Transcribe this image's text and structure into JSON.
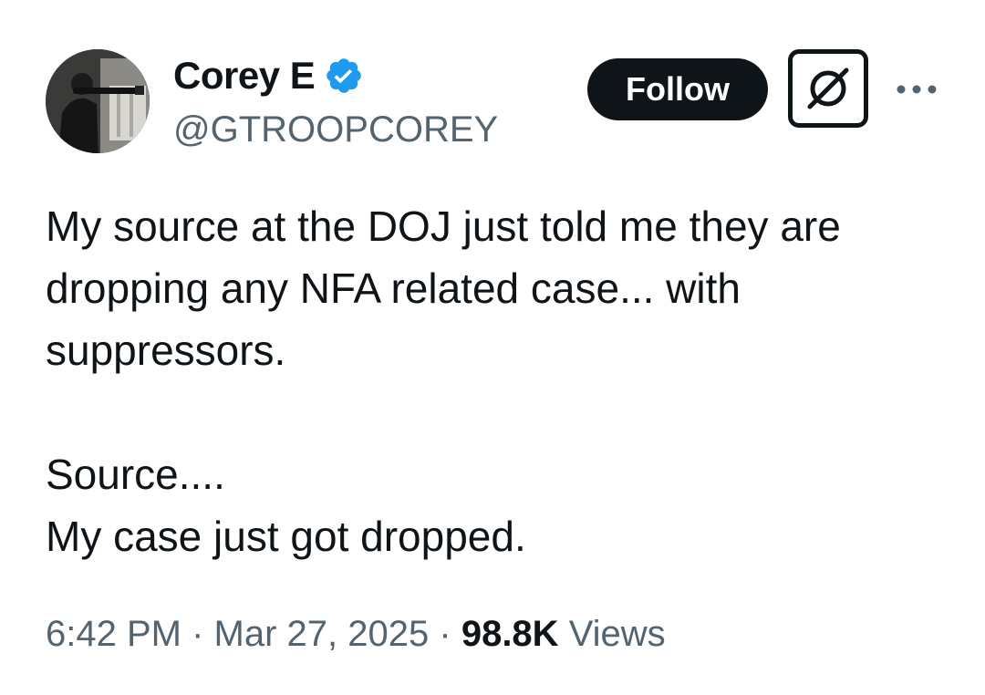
{
  "author": {
    "display_name": "Corey E",
    "handle": "@GTROOPCOREY",
    "verified": true,
    "verified_color": "#1d9bf0"
  },
  "actions": {
    "follow_label": "Follow",
    "grok_icon": "slashed-circle-icon",
    "more_icon": "ellipsis-icon"
  },
  "tweet": {
    "paragraph_1": "My source at the DOJ just told me they are dropping any NFA related case... with suppressors.",
    "paragraph_2_line_1": "Source....",
    "paragraph_2_line_2": "My case just got dropped."
  },
  "meta": {
    "time": "6:42 PM",
    "separator": "·",
    "date": "Mar 27, 2025",
    "views_count": "98.8K",
    "views_label": "Views"
  },
  "colors": {
    "text": "#0f1419",
    "secondary": "#536471",
    "button_bg": "#0f1419"
  }
}
